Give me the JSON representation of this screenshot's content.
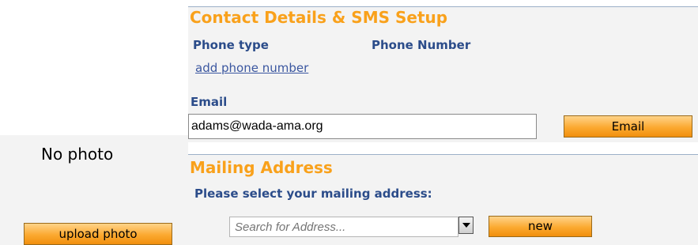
{
  "photo": {
    "empty_text": "No photo",
    "upload_label": "upload photo"
  },
  "contact": {
    "heading": "Contact Details & SMS Setup",
    "phone_type_label": "Phone type",
    "phone_number_label": "Phone Number",
    "add_phone_link": "add phone number",
    "email_label": "Email",
    "email_value": "adams@wada-ama.org",
    "email_button": "Email"
  },
  "mailing": {
    "heading": "Mailing Address",
    "prompt": "Please select your mailing address:",
    "search_placeholder": "Search for Address...",
    "new_button": "new",
    "dropdown_icon": "triangle-down"
  },
  "colors": {
    "heading_orange": "#f9a11b",
    "label_blue": "#2b4c8a",
    "button_orange": "#fba930",
    "panel_bg": "#f3f3f3"
  }
}
